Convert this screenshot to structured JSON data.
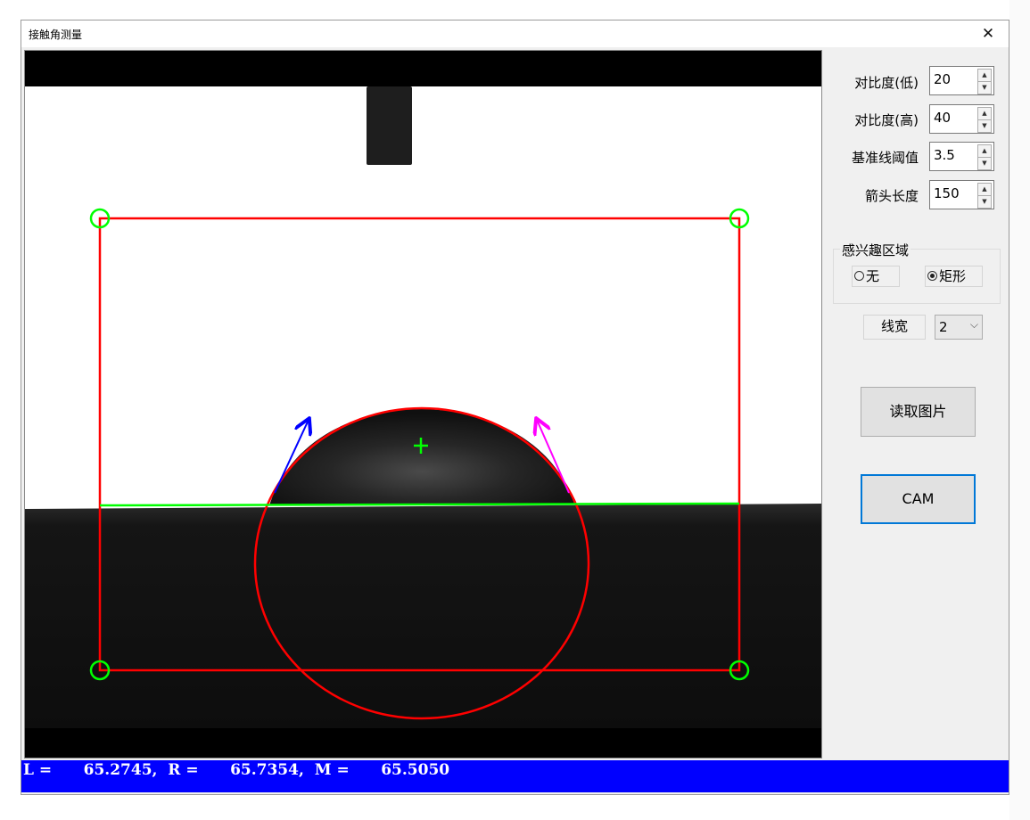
{
  "window": {
    "title": "接触角测量",
    "close_label": "✕"
  },
  "params": [
    {
      "label": "对比度(低)",
      "value": "20"
    },
    {
      "label": "对比度(高)",
      "value": "40"
    },
    {
      "label": "基准线阈值",
      "value": "3.5"
    },
    {
      "label": "箭头长度",
      "value": "150"
    }
  ],
  "roi": {
    "title": "感兴趣区域",
    "options": [
      "无",
      "矩形"
    ],
    "selected": "矩形"
  },
  "line_width": {
    "label": "线宽",
    "value": "2"
  },
  "buttons": {
    "read_image": "读取图片",
    "cam": "CAM"
  },
  "status": {
    "text": "L =      65.2745,  R =      65.7354,  M =      65.5050"
  },
  "overlay_colors": {
    "roi": "#ff0000",
    "baseline": "#00ff00",
    "left_tangent": "#0000ff",
    "right_tangent": "#ff00ff",
    "status_bar": "#0000ff"
  },
  "icons": {
    "spin_up": "up-arrow-icon",
    "spin_down": "down-arrow-icon",
    "dropdown": "chevron-down-icon",
    "center_marker": "crosshair-icon"
  }
}
